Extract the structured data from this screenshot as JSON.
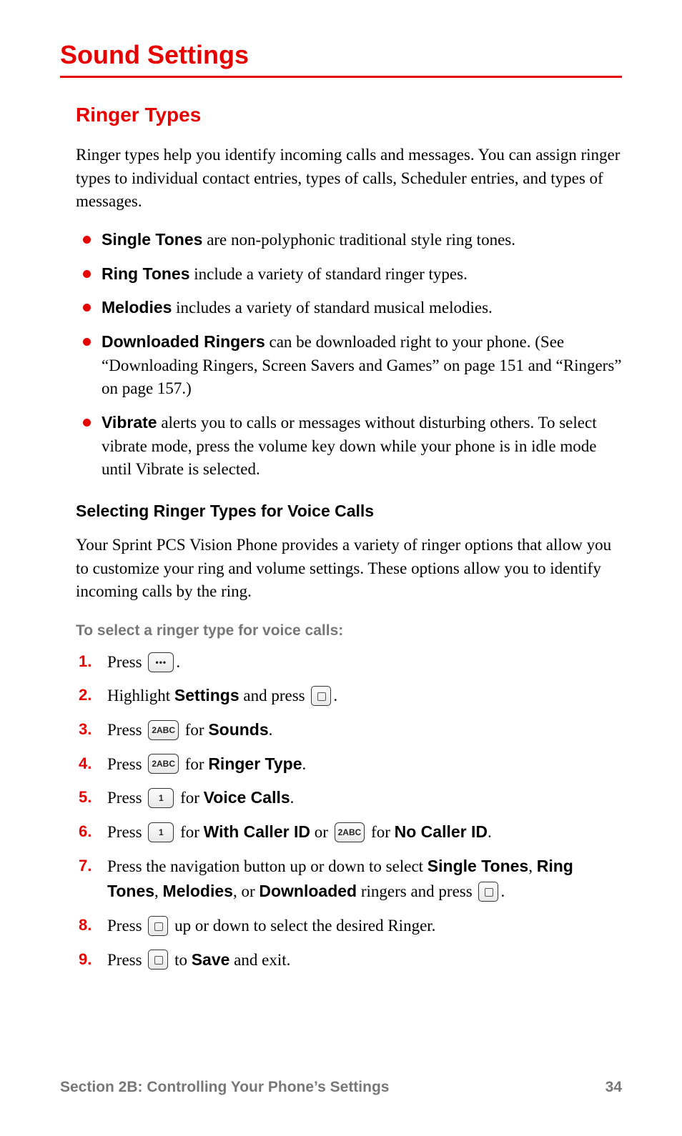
{
  "title": "Sound Settings",
  "section": {
    "heading": "Ringer Types",
    "intro": "Ringer types help you identify incoming calls and messages. You can assign ringer types to individual contact entries, types of calls, Scheduler entries, and types of messages.",
    "bullets": [
      {
        "term": "Single Tones",
        "rest": " are non-polyphonic traditional style ring tones."
      },
      {
        "term": "Ring Tones",
        "rest": " include a variety of standard ringer types."
      },
      {
        "term": "Melodies",
        "rest": " includes a variety of standard musical melodies."
      },
      {
        "term": "Downloaded Ringers",
        "rest": " can be downloaded right to your phone. (See “Downloading Ringers, Screen Savers and Games” on page 151 and “Ringers” on page 157.)"
      },
      {
        "term": "Vibrate",
        "rest": " alerts you to calls or messages without disturbing others. To select vibrate mode, press the volume key down while your phone is in idle mode until Vibrate is selected."
      }
    ],
    "subheading": "Selecting Ringer Types for Voice Calls",
    "sub_intro": "Your Sprint PCS Vision Phone provides a variety of ringer options that allow you to customize your ring and volume settings. These options allow you to identify incoming calls by the ring.",
    "lead_in": "To select a ringer type for voice calls:",
    "steps": {
      "s1": {
        "pre": "Press ",
        "post": "."
      },
      "s2": {
        "pre": "Highlight ",
        "bold1": "Settings",
        "mid": " and press ",
        "post": "."
      },
      "s3": {
        "pre": "Press ",
        "key": "2ABC",
        "mid": " for ",
        "bold1": "Sounds",
        "post": "."
      },
      "s4": {
        "pre": "Press ",
        "key": "2ABC",
        "mid": " for ",
        "bold1": "Ringer Type",
        "post": "."
      },
      "s5": {
        "pre": "Press ",
        "key": "1",
        "mid": " for ",
        "bold1": "Voice Calls",
        "post": "."
      },
      "s6": {
        "pre": "Press ",
        "key1": "1",
        "mid1": " for ",
        "bold1": "With Caller ID",
        "mid2": " or ",
        "key2": "2ABC",
        "mid3": " for ",
        "bold2": "No Caller ID",
        "post": "."
      },
      "s7": {
        "pre": "Press the navigation button up or down to select ",
        "bold1": "Single Tones",
        "sep1": ", ",
        "bold2": "Ring Tones",
        "sep2": ", ",
        "bold3": "Melodies",
        "sep3": ", or ",
        "bold4": "Downloaded",
        "mid": " ringers and press ",
        "post": "."
      },
      "s8": {
        "pre": "Press ",
        "mid": " up or down to select the desired Ringer."
      },
      "s9": {
        "pre": "Press ",
        "mid": " to ",
        "bold1": "Save",
        "post": " and exit."
      }
    }
  },
  "footer": {
    "section_label": "Section 2B: Controlling Your Phone’s Settings",
    "page_number": "34"
  },
  "icons": {
    "menu_key": "menu",
    "ok_key": "ok",
    "key_2abc": "2ABC",
    "key_1": "1"
  }
}
